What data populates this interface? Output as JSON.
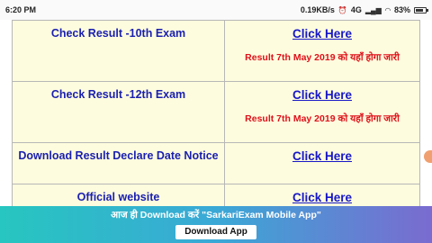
{
  "status_bar": {
    "time": "6:20 PM",
    "network_speed": "0.19KB/s",
    "network_type": "4G",
    "battery_percent": "83%",
    "battery_level": 0.83,
    "icons": [
      "alarm-icon",
      "signal-icon",
      "wifi-icon",
      "battery-icon"
    ]
  },
  "table": {
    "rows": [
      {
        "label": "Check Result -10th Exam",
        "link": "Click Here",
        "note": "Result 7th May 2019 को यहाँ होगा जारी"
      },
      {
        "label": "Check Result -12th Exam",
        "link": "Click Here",
        "note": "Result 7th May 2019 को यहाँ होगा जारी"
      },
      {
        "label": "Download Result Declare Date Notice",
        "link": "Click Here",
        "note": ""
      },
      {
        "label": "Official website",
        "link": "Click Here",
        "note": ""
      }
    ],
    "colors": {
      "label": "#1a1fb0",
      "link": "#1717c9",
      "note": "#e0101a",
      "background": "#fdfcde"
    }
  },
  "banner": {
    "text": "आज ही Download करें \"SarkariExam Mobile App\"",
    "button_label": "Download App"
  }
}
